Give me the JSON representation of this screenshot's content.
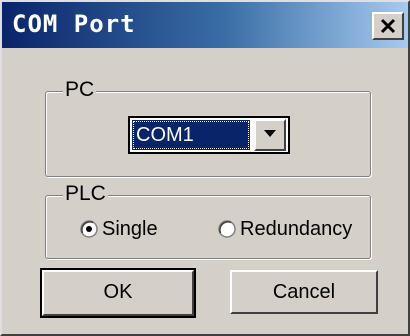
{
  "window": {
    "title": "COM Port"
  },
  "pc_group": {
    "legend": "PC",
    "com_select": {
      "selected": "COM1"
    }
  },
  "plc_group": {
    "legend": "PLC",
    "options": [
      {
        "label": "Single",
        "checked": true
      },
      {
        "label": "Redundancy",
        "checked": false
      }
    ]
  },
  "buttons": {
    "ok_label": "OK",
    "cancel_label": "Cancel"
  },
  "icons": {
    "close": "close-icon",
    "dropdown": "chevron-down-icon",
    "radio": "radio-icon"
  },
  "colors": {
    "titlebar_start": "#0a246a",
    "titlebar_end": "#a6caf0",
    "face": "#d4d0c8",
    "selection": "#0a246a"
  }
}
